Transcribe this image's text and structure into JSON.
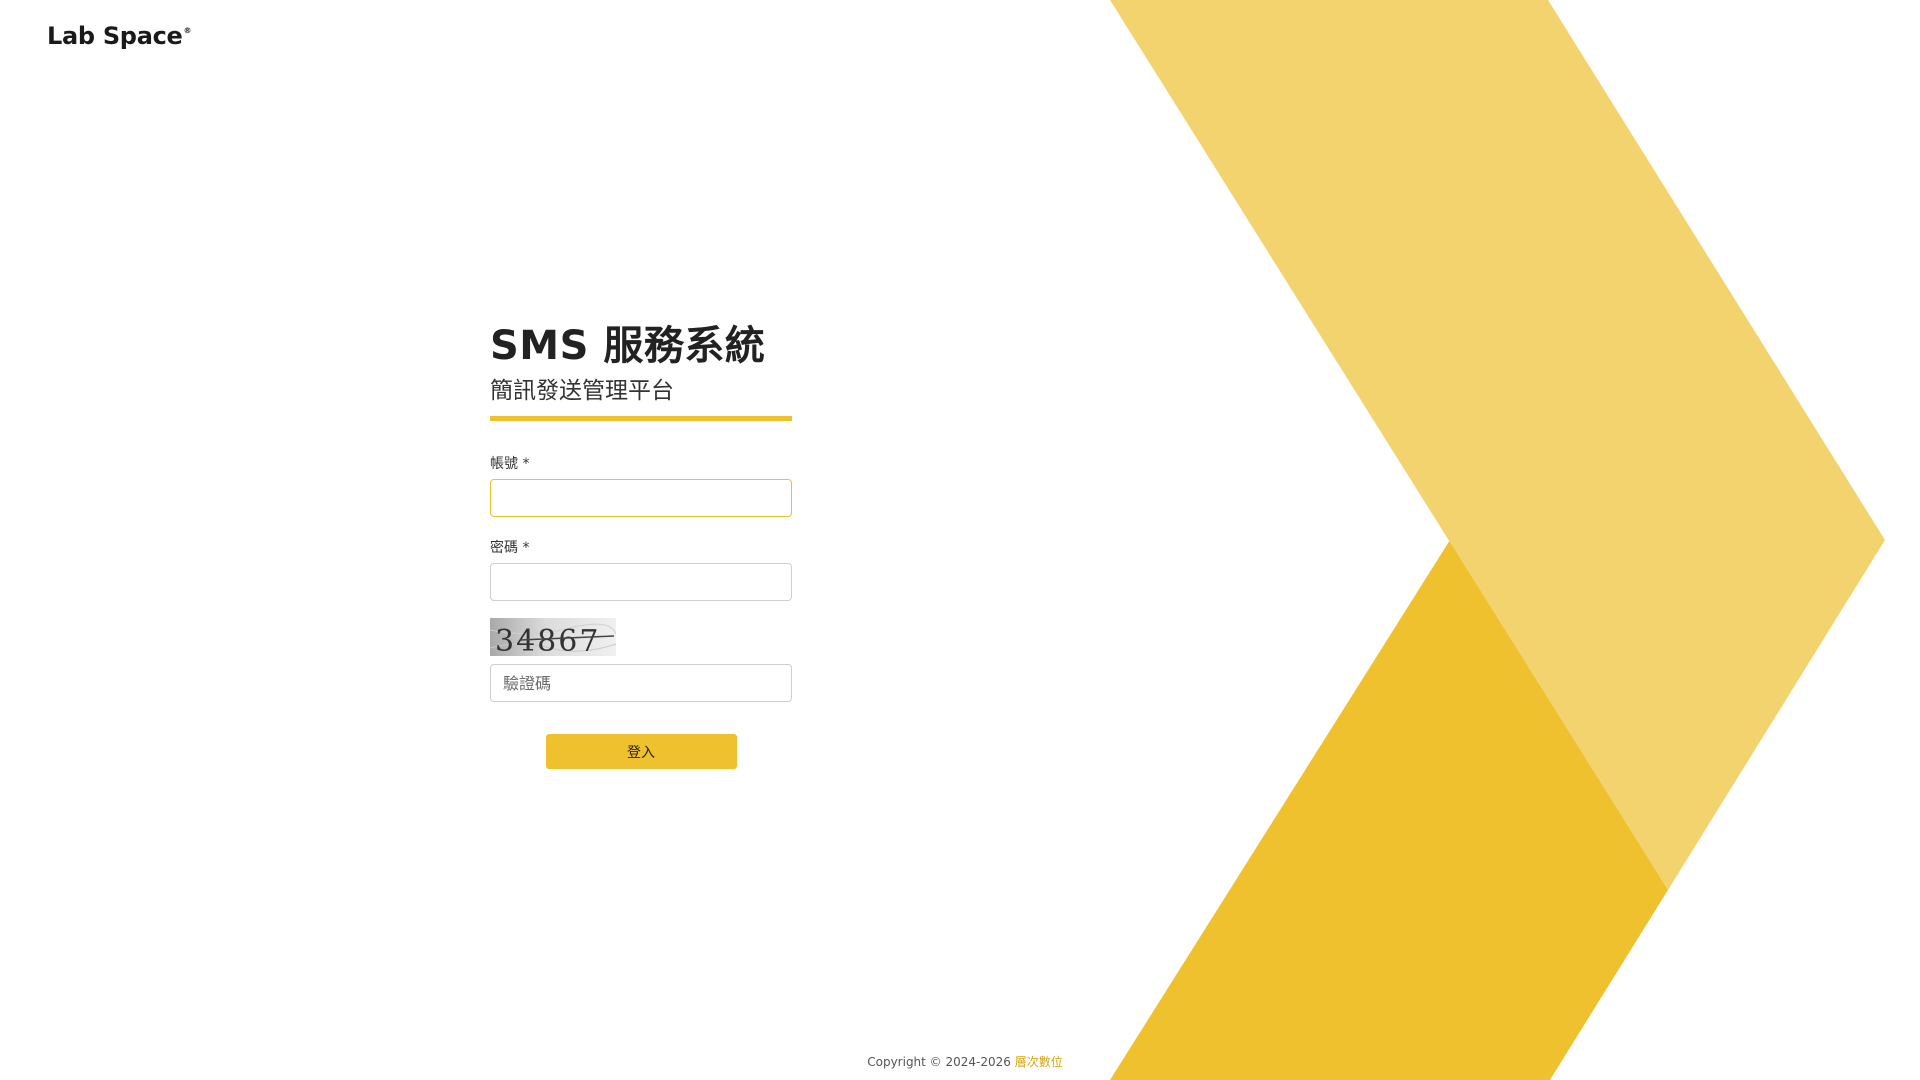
{
  "brand": {
    "name": "Lab Space",
    "registered_mark": "®"
  },
  "login": {
    "title": "SMS 服務系統",
    "subtitle": "簡訊發送管理平台",
    "account_label": "帳號 *",
    "account_value": "",
    "password_label": "密碼 *",
    "password_value": "",
    "captcha_text": "34867",
    "captcha_placeholder": "驗證碼",
    "submit_label": "登入"
  },
  "footer": {
    "copyright": "Copyright © 2024-2026",
    "company": "層次數位"
  },
  "colors": {
    "accent": "#EFC12F",
    "accent_light": "#F2D36E",
    "link": "#D9A514"
  }
}
